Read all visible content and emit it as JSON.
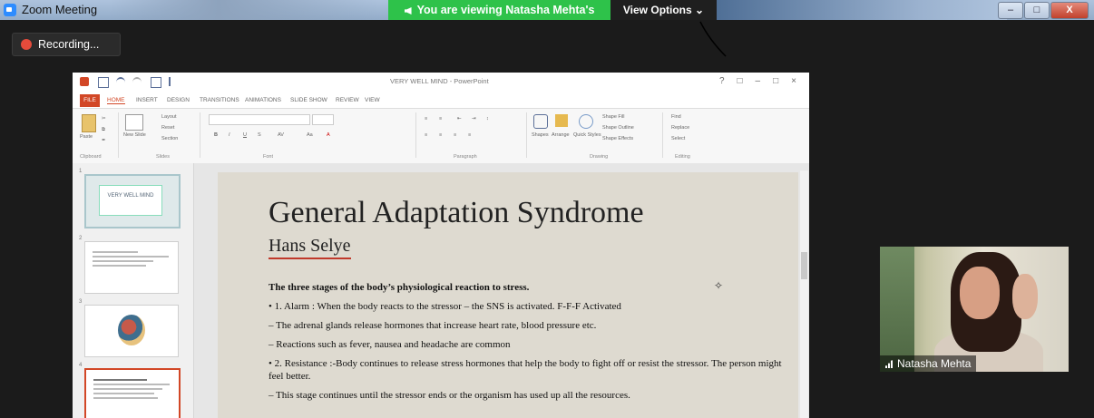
{
  "zoom": {
    "window_title": "Zoom Meeting",
    "share_banner": "You are viewing Natasha Mehta's screen",
    "view_options_label": "View Options",
    "recording_label": "Recording...",
    "window_controls": [
      "–",
      "□",
      "X"
    ]
  },
  "powerpoint": {
    "document_title": "VERY WELL MIND - PowerPoint",
    "tabs": [
      "FILE",
      "HOME",
      "INSERT",
      "DESIGN",
      "TRANSITIONS",
      "ANIMATIONS",
      "SLIDE SHOW",
      "REVIEW",
      "VIEW"
    ],
    "ribbon": {
      "clipboard_label": "Clipboard",
      "paste_label": "Paste",
      "slides_label": "Slides",
      "new_slide_label": "New Slide",
      "layout_label": "Layout",
      "reset_label": "Reset",
      "section_label": "Section",
      "font_label": "Font",
      "paragraph_label": "Paragraph",
      "drawing_label": "Drawing",
      "shapes_label": "Shapes",
      "arrange_label": "Arrange",
      "quick_styles_label": "Quick Styles",
      "shape_fill_label": "Shape Fill",
      "shape_outline_label": "Shape Outline",
      "shape_effects_label": "Shape Effects",
      "editing_label": "Editing",
      "find_label": "Find",
      "replace_label": "Replace",
      "select_label": "Select"
    },
    "thumbnails": [
      {
        "num": "1",
        "title": "VERY WELL MIND"
      },
      {
        "num": "2"
      },
      {
        "num": "3"
      },
      {
        "num": "4"
      }
    ],
    "slide": {
      "title": "General Adaptation Syndrome",
      "subtitle": "Hans Selye",
      "lines": [
        "The three stages of the body’s physiological reaction to stress.",
        "• 1. Alarm : When the body reacts to the stressor – the SNS is activated. F-F-F Activated",
        "– The adrenal glands release hormones that increase heart rate, blood pressure etc.",
        "– Reactions such as fever, nausea and headache are common",
        "• 2. Resistance :-Body continues to release stress hormones that help the body to fight off or resist the stressor. The person might feel better.",
        "– This stage continues until the stressor ends or the organism has used up all the resources."
      ]
    }
  },
  "participant": {
    "name": "Natasha Mehta"
  },
  "colors": {
    "share_banner": "#2ec24a",
    "ppt_accent": "#d24726",
    "slide_bg": "#dedad0"
  }
}
